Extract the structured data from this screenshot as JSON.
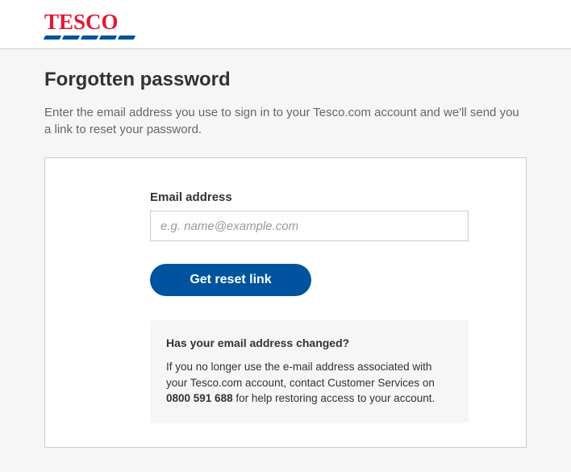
{
  "brand": {
    "name": "TESCO"
  },
  "page": {
    "title": "Forgotten password",
    "intro": "Enter the email address you use to sign in to your Tesco.com account and we'll send you a link to reset your password."
  },
  "form": {
    "email_label": "Email address",
    "email_placeholder": "e.g. name@example.com",
    "submit_label": "Get reset link"
  },
  "help": {
    "title": "Has your email address changed?",
    "body_before_phone": "If you no longer use the e-mail address associated with your Tesco.com account, contact Customer Services on ",
    "phone": "0800 591 688",
    "body_after_phone": " for help restoring access to your account."
  }
}
